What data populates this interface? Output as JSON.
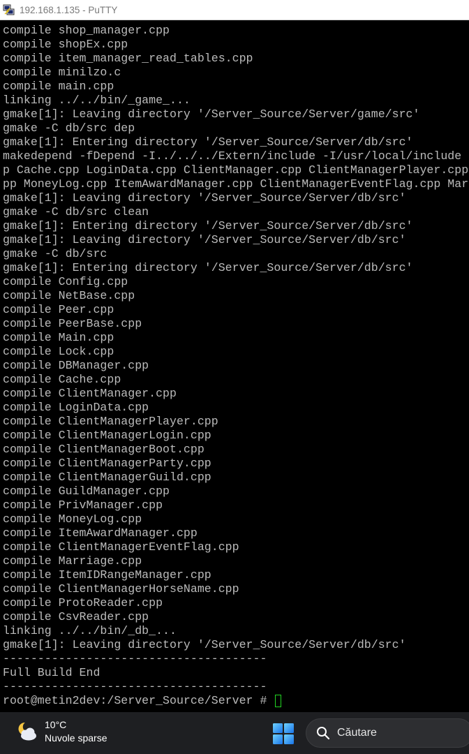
{
  "window": {
    "title": "192.168.1.135 - PuTTY"
  },
  "terminal": {
    "lines": [
      "compile shop_manager.cpp",
      "compile shopEx.cpp",
      "compile item_manager_read_tables.cpp",
      "compile minilzo.c",
      "compile main.cpp",
      "linking ../../bin/_game_...",
      "gmake[1]: Leaving directory '/Server_Source/Server/game/src'",
      "gmake -C db/src dep",
      "gmake[1]: Entering directory '/Server_Source/Server/db/src'",
      "makedepend -fDepend -I../../../Extern/include -I/usr/local/include",
      "p Cache.cpp LoginData.cpp ClientManager.cpp ClientManagerPlayer.cpp",
      "pp MoneyLog.cpp ItemAwardManager.cpp ClientManagerEventFlag.cpp Mar",
      "gmake[1]: Leaving directory '/Server_Source/Server/db/src'",
      "gmake -C db/src clean",
      "gmake[1]: Entering directory '/Server_Source/Server/db/src'",
      "gmake[1]: Leaving directory '/Server_Source/Server/db/src'",
      "gmake -C db/src",
      "gmake[1]: Entering directory '/Server_Source/Server/db/src'",
      "compile Config.cpp",
      "compile NetBase.cpp",
      "compile Peer.cpp",
      "compile PeerBase.cpp",
      "compile Main.cpp",
      "compile Lock.cpp",
      "compile DBManager.cpp",
      "compile Cache.cpp",
      "compile ClientManager.cpp",
      "compile LoginData.cpp",
      "compile ClientManagerPlayer.cpp",
      "compile ClientManagerLogin.cpp",
      "compile ClientManagerBoot.cpp",
      "compile ClientManagerParty.cpp",
      "compile ClientManagerGuild.cpp",
      "compile GuildManager.cpp",
      "compile PrivManager.cpp",
      "compile MoneyLog.cpp",
      "compile ItemAwardManager.cpp",
      "compile ClientManagerEventFlag.cpp",
      "compile Marriage.cpp",
      "compile ItemIDRangeManager.cpp",
      "compile ClientManagerHorseName.cpp",
      "compile ProtoReader.cpp",
      "compile CsvReader.cpp",
      "linking ../../bin/_db_...",
      "gmake[1]: Leaving directory '/Server_Source/Server/db/src'",
      "--------------------------------------",
      "Full Build End",
      "--------------------------------------"
    ],
    "prompt": "root@metin2dev:/Server_Source/Server # ",
    "cursor_color": "#22d422",
    "text_color": "#bbbbbb",
    "background_color": "#000000"
  },
  "taskbar": {
    "weather": {
      "temperature": "10°C",
      "description": "Nuvole sparse",
      "icon": "partly-cloudy-night-icon"
    },
    "start_icon": "windows-logo-icon",
    "search": {
      "label": "Căutare",
      "icon": "search-icon"
    }
  }
}
